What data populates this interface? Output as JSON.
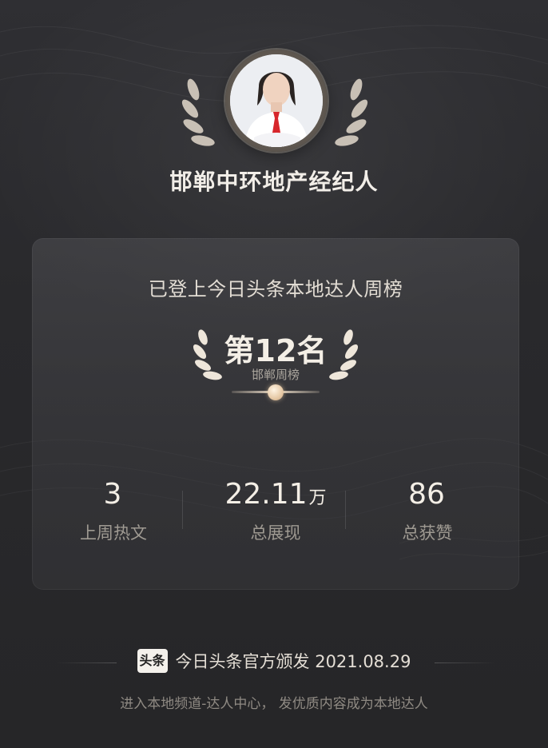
{
  "header": {
    "name": "邯郸中环地产经纪人",
    "avatar_icon": "person-portrait-icon"
  },
  "card": {
    "title": "已登上今日头条本地达人周榜",
    "rank": "第12名",
    "rank_sub": "邯郸周榜",
    "stats": [
      {
        "value": "3",
        "unit": "",
        "label": "上周热文"
      },
      {
        "value": "22.11",
        "unit": "万",
        "label": "总展现"
      },
      {
        "value": "86",
        "unit": "",
        "label": "总获赞"
      }
    ]
  },
  "footer": {
    "brand_badge": "头条",
    "issued": "今日头条官方颁发 2021.08.29",
    "hint": "进入本地频道-达人中心， 发优质内容成为本地达人"
  },
  "colors": {
    "background": "#2b2b2e",
    "card": "#47474b",
    "accent_gold": "#e8d9c4",
    "text_primary": "#f4efe6",
    "text_muted": "#9f9a92"
  }
}
